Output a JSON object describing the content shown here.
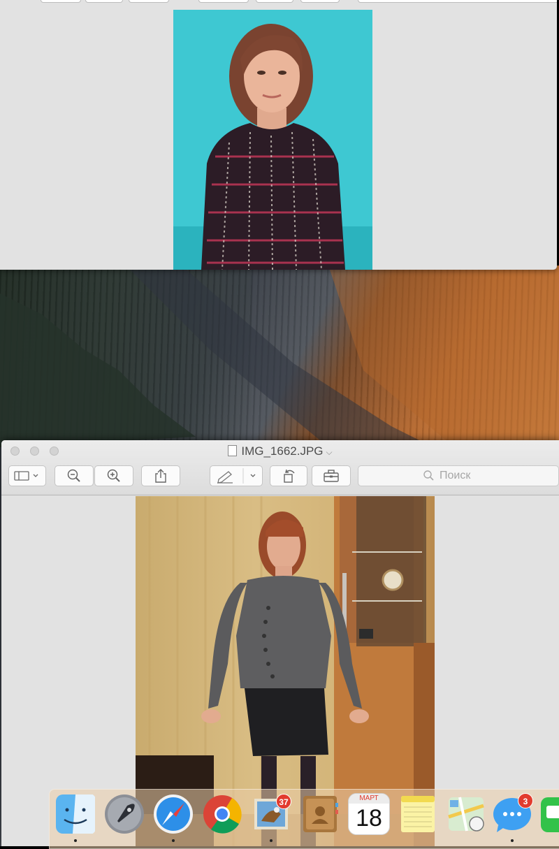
{
  "bottom_window": {
    "title": "IMG_1662.JPG",
    "search_placeholder": "Поиск"
  },
  "dock": {
    "apps": [
      {
        "name": "Finder",
        "icon": "finder-icon",
        "running": true
      },
      {
        "name": "Launchpad",
        "icon": "launchpad-rocket-icon",
        "running": false
      },
      {
        "name": "Safari",
        "icon": "safari-compass-icon",
        "running": true
      },
      {
        "name": "Chrome",
        "icon": "chrome-icon",
        "running": false
      },
      {
        "name": "Mail",
        "icon": "mail-icon",
        "running": true,
        "badge": "37"
      },
      {
        "name": "Contacts",
        "icon": "contacts-icon",
        "running": false
      },
      {
        "name": "Calendar",
        "icon": "calendar-icon",
        "running": false,
        "month": "МАРТ",
        "day": "18"
      },
      {
        "name": "Notes",
        "icon": "notes-icon",
        "running": false
      },
      {
        "name": "Maps",
        "icon": "maps-icon",
        "running": false
      },
      {
        "name": "Messages",
        "icon": "messages-icon",
        "running": true,
        "badge": "3"
      },
      {
        "name": "FaceTime",
        "icon": "facetime-icon",
        "running": false
      }
    ]
  },
  "colors": {
    "window_bg": "#e2e2e2",
    "badge_red": "#e23b2e",
    "photo1_backdrop": "#3fcad4"
  }
}
